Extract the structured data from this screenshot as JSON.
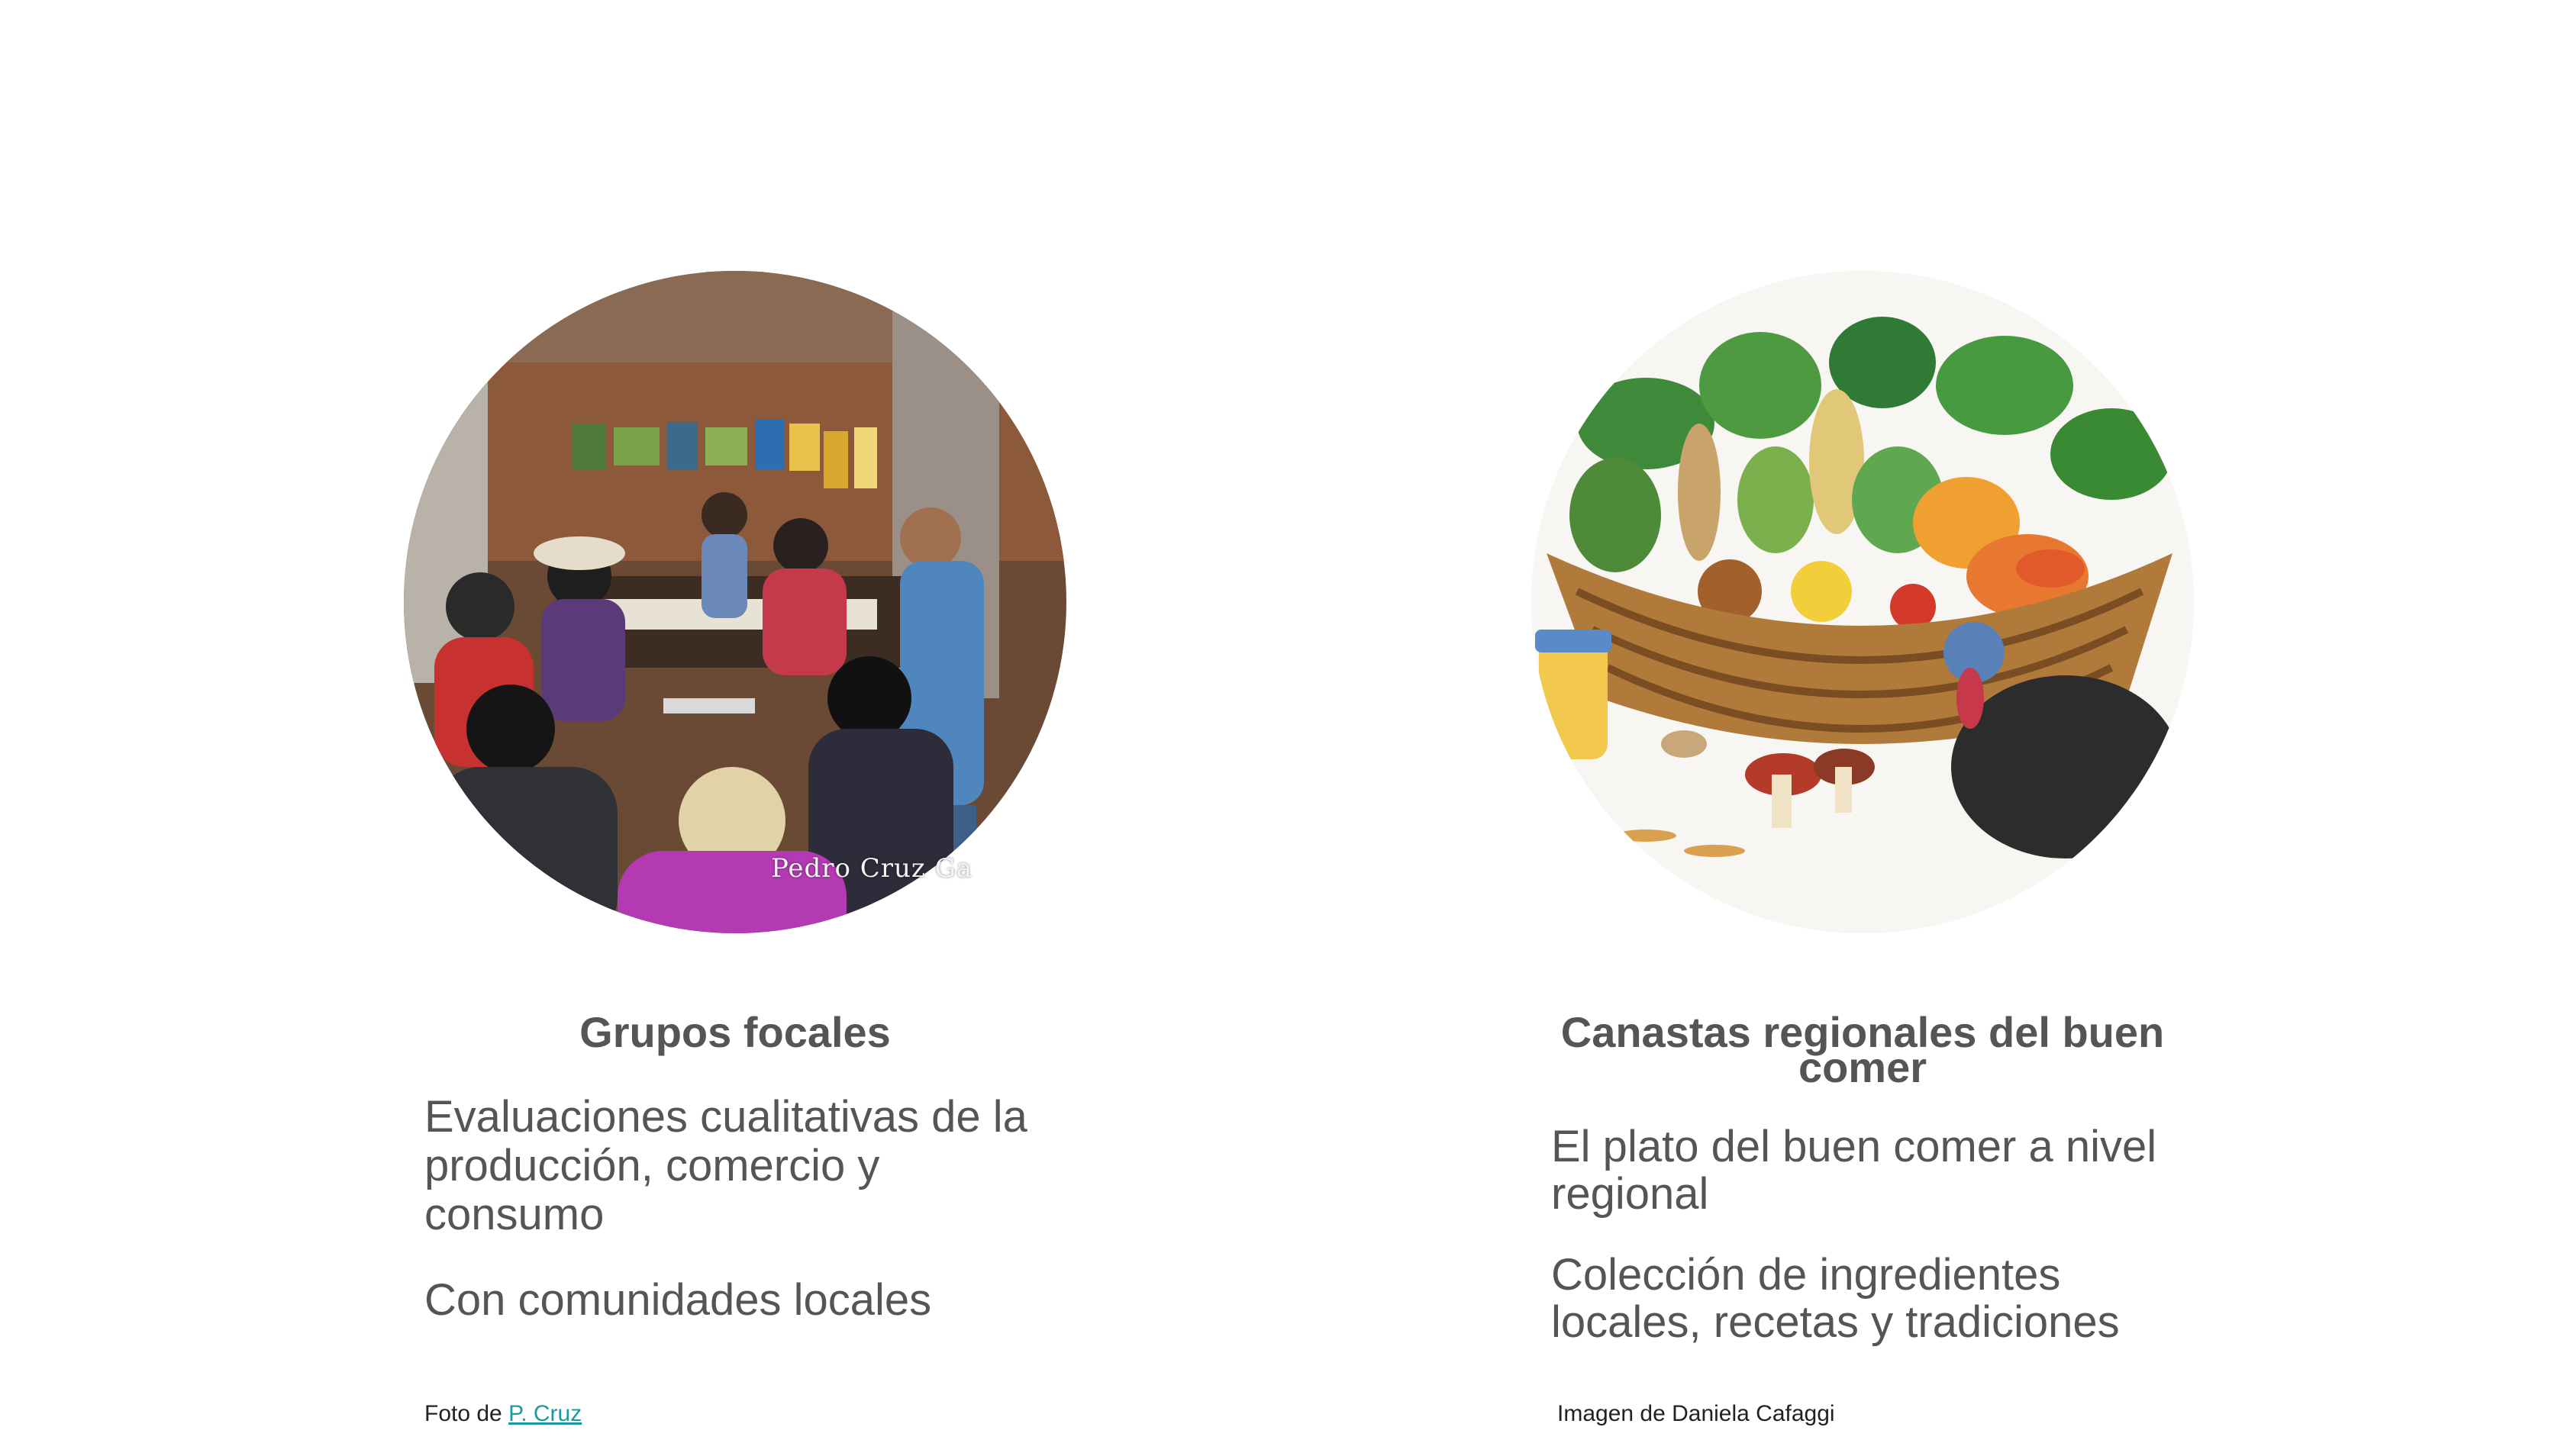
{
  "left_card": {
    "image_name": "focus-group-photo",
    "watermark": "Pedro Cruz Ga",
    "title": "Grupos focales",
    "paragraph_1": "Evaluaciones cualitativas de la producción, comercio y consumo",
    "paragraph_2": "Con comunidades locales",
    "caption_prefix": "Foto de ",
    "caption_link": "P. Cruz"
  },
  "right_card": {
    "image_name": "regional-food-basket-illustration",
    "title": "Canastas regionales del buen comer",
    "paragraph_1": "El plato del buen comer a nivel regional",
    "paragraph_2": "Colección de ingredientes locales, recetas y tradiciones",
    "caption": "Imagen de Daniela Cafaggi"
  },
  "colors": {
    "text": "#555555",
    "link": "#1a9ba1"
  }
}
